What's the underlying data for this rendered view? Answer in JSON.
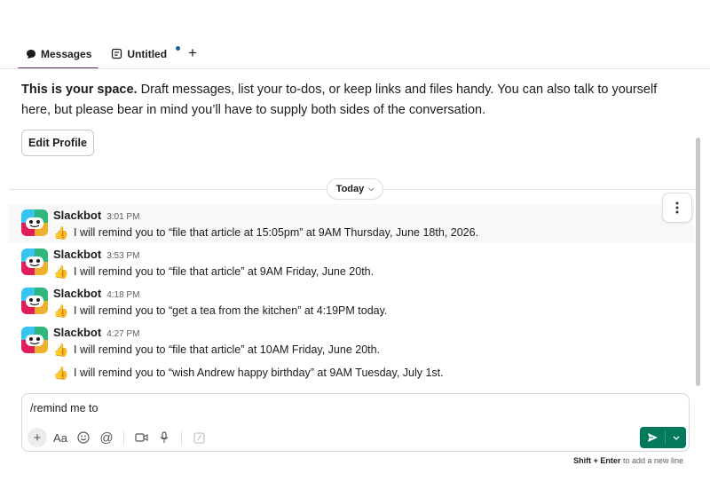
{
  "tabs": [
    {
      "label": "Messages",
      "icon": "message-bubble-icon",
      "active": true
    },
    {
      "label": "Untitled",
      "icon": "canvas-doc-icon",
      "active": false
    }
  ],
  "add_tab_icon": "plus-icon",
  "intro": {
    "bold": "This is your space.",
    "text": " Draft messages, list your to-dos, or keep links and files handy. You can also talk to yourself here, but please bear in mind you’ll have to supply both sides of the conversation."
  },
  "edit_profile_label": "Edit Profile",
  "day_divider": "Today",
  "messages": [
    {
      "sender": "Slackbot",
      "time": "3:01 PM",
      "lines": [
        "I will remind you to “file that article at 15:05pm” at 9AM Thursday, June 18th, 2026."
      ]
    },
    {
      "sender": "Slackbot",
      "time": "3:53 PM",
      "lines": [
        "I will remind you to “file that article” at 9AM Friday, June 20th."
      ]
    },
    {
      "sender": "Slackbot",
      "time": "4:18 PM",
      "lines": [
        "I will remind you to “get a tea from the kitchen” at 4:19PM today."
      ]
    },
    {
      "sender": "Slackbot",
      "time": "4:27 PM",
      "lines": [
        "I will remind you to “file that article” at 10AM Friday, June 20th.",
        "I will remind you to “wish Andrew happy birthday” at 9AM Tuesday, July 1st."
      ]
    }
  ],
  "composer": {
    "value": "/remind me to",
    "format_label": "Aa"
  },
  "hint": {
    "keys": "Shift + Enter",
    "text": " to add a new line"
  },
  "colors": {
    "send_button": "#007a5a",
    "active_tab_underline": "#5b2c6f",
    "thumbs_emoji": "#f2b531"
  }
}
